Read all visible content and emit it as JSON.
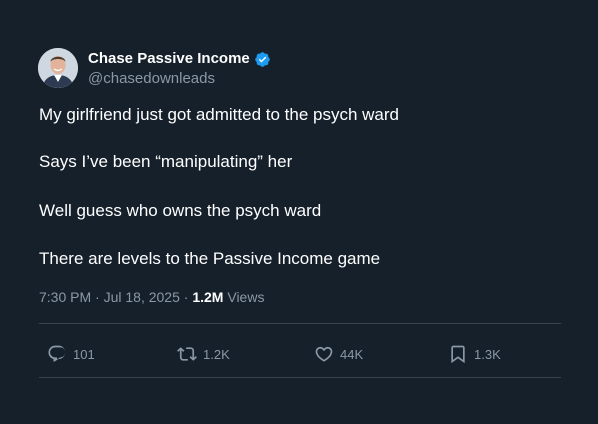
{
  "author": {
    "display_name": "Chase Passive Income",
    "handle": "@chasedownleads",
    "verified": true
  },
  "tweet": {
    "lines": [
      "My girlfriend just got admitted to the psych ward",
      "Says I’ve been “manipulating” her",
      "Well guess who owns the psych ward",
      "There are levels to the Passive Income game"
    ]
  },
  "meta": {
    "time": "7:30 PM",
    "separator": "·",
    "date": "Jul 18, 2025",
    "views_count": "1.2M",
    "views_label": "Views"
  },
  "actions": {
    "reply": {
      "icon": "reply-icon",
      "count": "101"
    },
    "repost": {
      "icon": "repost-icon",
      "count": "1.2K"
    },
    "like": {
      "icon": "heart-icon",
      "count": "44K"
    },
    "bookmark": {
      "icon": "bookmark-icon",
      "count": "1.3K"
    }
  },
  "colors": {
    "background": "#15202b",
    "text_primary": "#ffffff",
    "text_secondary": "#8b98a5",
    "divider": "#38444d",
    "verified": "#1d9bf0"
  }
}
